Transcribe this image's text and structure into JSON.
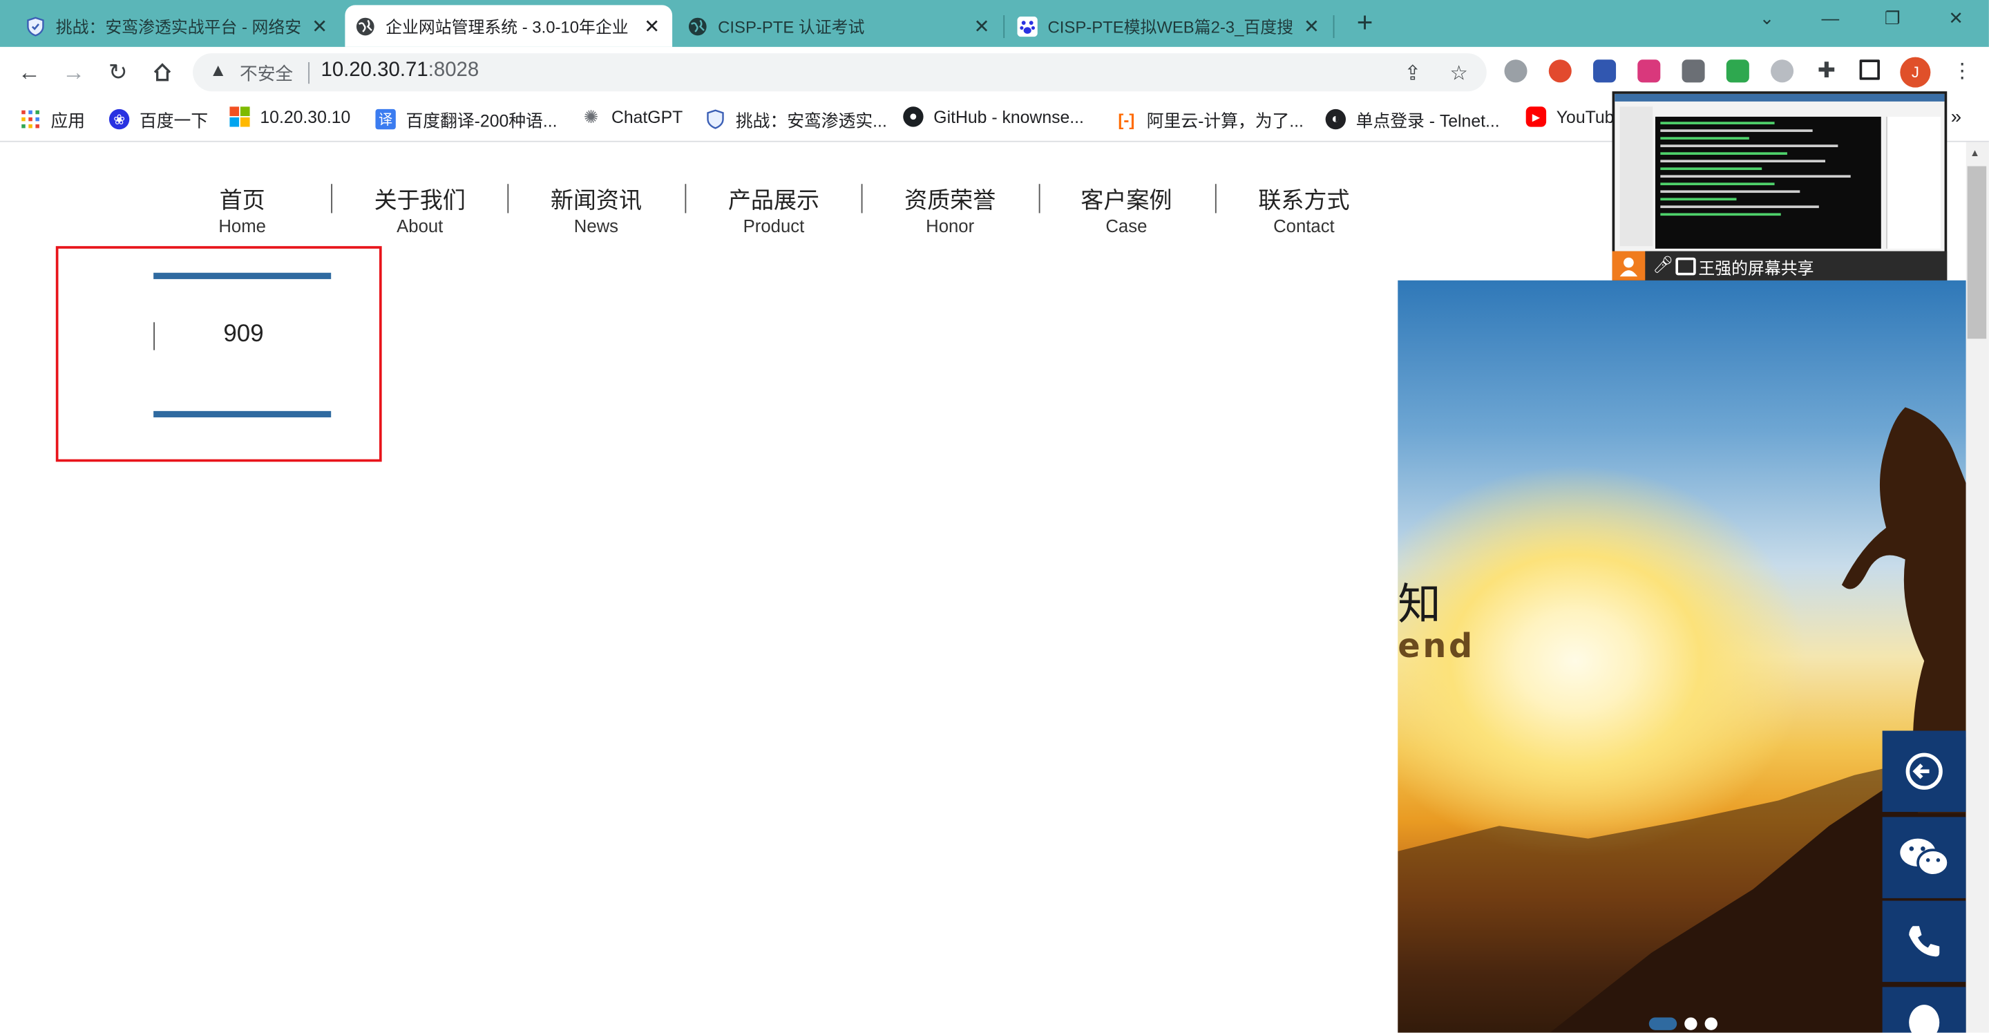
{
  "tabs": [
    {
      "title": "挑战：安鸾渗透实战平台 - 网络安全",
      "active": false
    },
    {
      "title": "企业网站管理系统 - 3.0-10年企业",
      "active": true
    },
    {
      "title": "CISP-PTE 认证考试",
      "active": false
    },
    {
      "title": "CISP-PTE模拟WEB篇2-3_百度搜",
      "active": false
    }
  ],
  "tab_close_glyph": "✕",
  "new_tab_glyph": "+",
  "window_controls": {
    "minimize": "—",
    "restore": "❐",
    "close": "✕"
  },
  "address_bar": {
    "security_label": "不安全",
    "host": "10.20.30.71",
    "port": ":8028"
  },
  "profile_initial": "J",
  "bookmarks": [
    {
      "label": "应用"
    },
    {
      "label": "百度一下"
    },
    {
      "label": "10.20.30.10"
    },
    {
      "label": "百度翻译-200种语..."
    },
    {
      "label": "ChatGPT"
    },
    {
      "label": "挑战：安鸾渗透实..."
    },
    {
      "label": "GitHub - knownse..."
    },
    {
      "label": "阿里云-计算，为了..."
    },
    {
      "label": "单点登录 - Telnet..."
    },
    {
      "label": "YouTub"
    }
  ],
  "bookmarks_more": "»",
  "nav": [
    {
      "cn": "首页",
      "en": "Home"
    },
    {
      "cn": "关于我们",
      "en": "About"
    },
    {
      "cn": "新闻资讯",
      "en": "News"
    },
    {
      "cn": "产品展示",
      "en": "Product"
    },
    {
      "cn": "资质荣誉",
      "en": "Honor"
    },
    {
      "cn": "客户案例",
      "en": "Case"
    },
    {
      "cn": "联系方式",
      "en": "Contact"
    }
  ],
  "counter_value": "909",
  "banner": {
    "text_cn": "知",
    "text_en": "end"
  },
  "screen_share": {
    "label": "王强的屏幕共享"
  },
  "colors": {
    "tab_strip": "#5bb6b8",
    "accent_blue": "#2f6aa0",
    "highlight_red": "#e8141b",
    "side_button": "#123a73"
  }
}
